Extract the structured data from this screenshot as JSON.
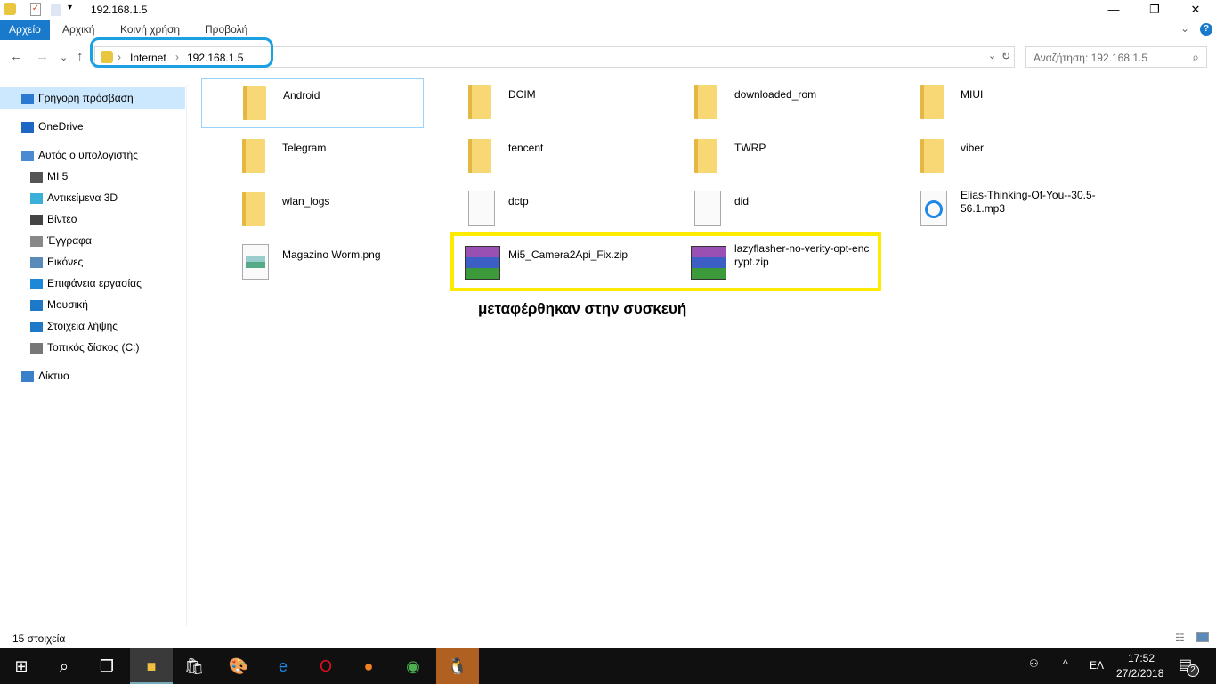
{
  "window": {
    "title": "192.168.1.5",
    "minimize": "—",
    "maximize": "❐",
    "close": "✕"
  },
  "ribbon": {
    "tabs": [
      "Αρχείο",
      "Αρχική",
      "Κοινή χρήση",
      "Προβολή"
    ],
    "help": "?",
    "collapse": "⌄"
  },
  "nav": {
    "back": "←",
    "forward": "→",
    "recent": "⌄",
    "up": "↑",
    "breadcrumb": [
      "Internet",
      "192.168.1.5"
    ],
    "search_placeholder": "Αναζήτηση: 192.168.1.5",
    "refresh": "↻",
    "search_icon": "⌕"
  },
  "sidebar": {
    "items": [
      {
        "label": "Γρήγορη πρόσβαση",
        "icon": "star-icon",
        "color": "#2b79d1"
      },
      {
        "label": "OneDrive",
        "icon": "cloud-icon",
        "color": "#1e66c4"
      },
      {
        "label": "Αυτός ο υπολογιστής",
        "icon": "computer-icon",
        "color": "#4b8ad0"
      },
      {
        "label": "MI 5",
        "icon": "phone-icon",
        "color": "#555"
      },
      {
        "label": "Αντικείμενα 3D",
        "icon": "cube-icon",
        "color": "#3ab0d8"
      },
      {
        "label": "Βίντεο",
        "icon": "film-icon",
        "color": "#444"
      },
      {
        "label": "Έγγραφα",
        "icon": "document-icon",
        "color": "#888"
      },
      {
        "label": "Εικόνες",
        "icon": "picture-icon",
        "color": "#5a8ab8"
      },
      {
        "label": "Επιφάνεια εργασίας",
        "icon": "desktop-icon",
        "color": "#1e88d8"
      },
      {
        "label": "Μουσική",
        "icon": "music-icon",
        "color": "#1e78c8"
      },
      {
        "label": "Στοιχεία λήψης",
        "icon": "download-icon",
        "color": "#1e78c8"
      },
      {
        "label": "Τοπικός δίσκος (C:)",
        "icon": "drive-icon",
        "color": "#777"
      },
      {
        "label": "Δίκτυο",
        "icon": "network-icon",
        "color": "#3a80c8"
      }
    ]
  },
  "files": [
    {
      "name": "Android",
      "type": "folder"
    },
    {
      "name": "DCIM",
      "type": "folder"
    },
    {
      "name": "downloaded_rom",
      "type": "folder"
    },
    {
      "name": "MIUI",
      "type": "folder"
    },
    {
      "name": "Telegram",
      "type": "folder"
    },
    {
      "name": "tencent",
      "type": "folder"
    },
    {
      "name": "TWRP",
      "type": "folder"
    },
    {
      "name": "viber",
      "type": "folder"
    },
    {
      "name": "wlan_logs",
      "type": "folder"
    },
    {
      "name": "dctp",
      "type": "file"
    },
    {
      "name": "did",
      "type": "file"
    },
    {
      "name": "Elias-Thinking-Of-You--30.5-56.1.mp3",
      "type": "mp3"
    },
    {
      "name": "Magazino Worm.png",
      "type": "image"
    },
    {
      "name": "Mi5_Camera2Api_Fix.zip",
      "type": "zip"
    },
    {
      "name": "lazyflasher-no-verity-opt-encrypt.zip",
      "type": "zip"
    }
  ],
  "annotation": "μεταφέρθηκαν στην συσκευή",
  "status": {
    "count": "15 στοιχεία"
  },
  "taskbar": {
    "time": "17:52",
    "date": "27/2/2018",
    "lang": "ΕΛ",
    "notifications": "2"
  }
}
